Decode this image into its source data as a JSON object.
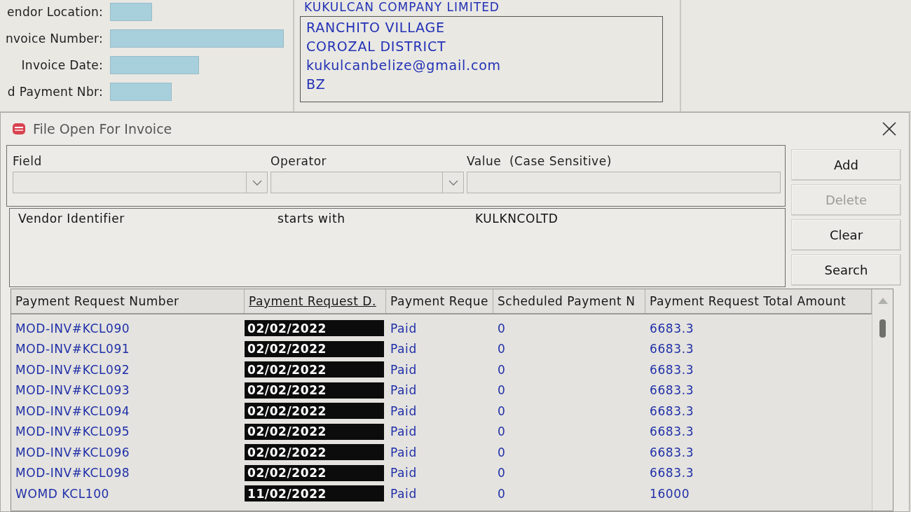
{
  "form": {
    "fields": [
      {
        "label": "endor Location:"
      },
      {
        "label": "nvoice Number:"
      },
      {
        "label": "Invoice Date:"
      },
      {
        "label": "d Payment Nbr:"
      }
    ]
  },
  "vendor": {
    "name": "KUKULCAN COMPANY LIMITED",
    "address": [
      "RANCHITO VILLAGE",
      "COROZAL DISTRICT",
      "kukulcanbelize@gmail.com",
      "BZ"
    ]
  },
  "dialog": {
    "title": "File Open For Invoice",
    "filter": [
      {
        "label": "Field",
        "kind": "dropdown"
      },
      {
        "label": "Operator",
        "kind": "dropdown"
      },
      {
        "label": "Value  (Case Sensitive)",
        "kind": "text"
      }
    ],
    "criteria": [
      {
        "field": "Vendor Identifier",
        "operator": "starts with",
        "value": "KULKNCOLTD"
      }
    ],
    "buttons": [
      {
        "label": "Add",
        "disabled": false
      },
      {
        "label": "Delete",
        "disabled": true
      },
      {
        "label": "Clear",
        "disabled": false
      },
      {
        "label": "Search",
        "disabled": false
      }
    ],
    "table": {
      "columns": [
        {
          "label": "Payment Request Number",
          "highlighted": false
        },
        {
          "label": "Payment Request D.",
          "highlighted": true
        },
        {
          "label": "Payment Reque",
          "highlighted": false
        },
        {
          "label": "Scheduled Payment N",
          "highlighted": false
        },
        {
          "label": "Payment Request Total Amount",
          "highlighted": false
        }
      ],
      "rows": [
        [
          "MOD-INV#KCL090",
          "02/02/2022",
          "Paid",
          "0",
          "6683.3"
        ],
        [
          "MOD-INV#KCL091",
          "02/02/2022",
          "Paid",
          "0",
          "6683.3"
        ],
        [
          "MOD-INV#KCL092",
          "02/02/2022",
          "Paid",
          "0",
          "6683.3"
        ],
        [
          "MOD-INV#KCL093",
          "02/02/2022",
          "Paid",
          "0",
          "6683.3"
        ],
        [
          "MOD-INV#KCL094",
          "02/02/2022",
          "Paid",
          "0",
          "6683.3"
        ],
        [
          "MOD-INV#KCL095",
          "02/02/2022",
          "Paid",
          "0",
          "6683.3"
        ],
        [
          "MOD-INV#KCL096",
          "02/02/2022",
          "Paid",
          "0",
          "6683.3"
        ],
        [
          "MOD-INV#KCL098",
          "02/02/2022",
          "Paid",
          "0",
          "6683.3"
        ],
        [
          "WOMD KCL100",
          "11/02/2022",
          "Paid",
          "0",
          "16000"
        ]
      ]
    }
  }
}
